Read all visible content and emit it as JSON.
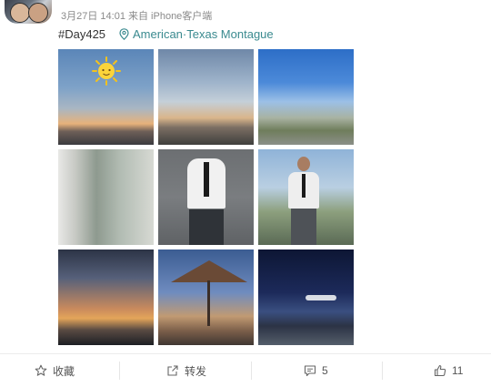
{
  "post": {
    "meta": "3月27日 14:01 来自 iPhone客户端",
    "topic": "#Day425",
    "location": "American·Texas Montague"
  },
  "photos": [
    {
      "name": "sunset-airfield-with-sun-sticker"
    },
    {
      "name": "sunset-clouds"
    },
    {
      "name": "blue-sky-street"
    },
    {
      "name": "window-reflection"
    },
    {
      "name": "pilot-uniform-portrait"
    },
    {
      "name": "pilot-outdoor-portrait"
    },
    {
      "name": "dramatic-sunset-clouds"
    },
    {
      "name": "patio-umbrella-evening"
    },
    {
      "name": "night-airport-plane"
    }
  ],
  "actions": {
    "favorite_label": "收藏",
    "repost_label": "转发",
    "comment_count": "5",
    "like_count": "11"
  },
  "colors": {
    "location_accent": "#3a8a8f",
    "meta_text": "#8a8a8a"
  }
}
